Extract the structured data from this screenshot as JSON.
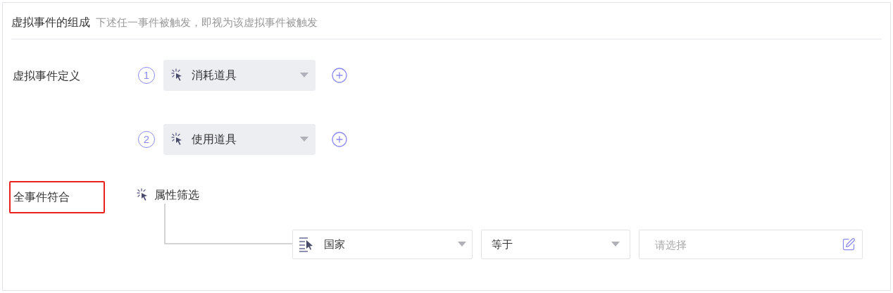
{
  "header": {
    "title": "虚拟事件的组成",
    "hint": "下述任一事件被触发，即视为该虚拟事件被触发"
  },
  "definition": {
    "label": "虚拟事件定义",
    "events": [
      {
        "index": "1",
        "value": "消耗道具"
      },
      {
        "index": "2",
        "value": "使用道具"
      }
    ]
  },
  "match": {
    "label": "全事件符合",
    "highlighted": true,
    "filter_button": "属性筛选",
    "condition": {
      "property": "国家",
      "operator": "等于",
      "value_placeholder": "请选择"
    }
  }
}
